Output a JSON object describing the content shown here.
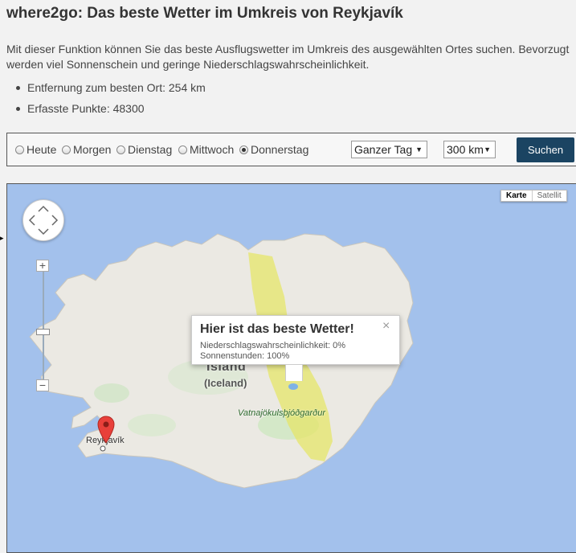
{
  "page": {
    "title": "where2go: Das beste Wetter im Umkreis von Reykjavík",
    "intro": "Mit dieser Funktion können Sie das beste Ausflugswetter im Umkreis des ausgewählten Ortes suchen. Bevorzugt werden viel Sonnenschein und geringe Niederschlagswahrscheinlichkeit.",
    "facts": [
      "Entfernung zum besten Ort: 254 km",
      "Erfasste Punkte: 48300"
    ]
  },
  "search": {
    "days": [
      {
        "label": "Heute",
        "checked": false
      },
      {
        "label": "Morgen",
        "checked": false
      },
      {
        "label": "Dienstag",
        "checked": false
      },
      {
        "label": "Mittwoch",
        "checked": false
      },
      {
        "label": "Donnerstag",
        "checked": true
      }
    ],
    "time_select": "Ganzer Tag",
    "radius_select": "300 km",
    "submit_label": "Suchen",
    "accent_color": "#1b4462"
  },
  "map": {
    "maptype_active": "Karte",
    "maptype_inactive": "Satellit",
    "zoom_in": "+",
    "zoom_out": "−",
    "country_label": "Ísland",
    "country_label_en": "(Iceland)",
    "park_label": "Vatnajökulsþjóðgarður",
    "city_label": "Reykjavík",
    "water_color": "#a3c1ec",
    "highlight_color": "#e5e66a"
  },
  "infowindow": {
    "title": "Hier ist das beste Wetter!",
    "precip_line": "Niederschlagswahrscheinlichkeit: 0%",
    "sun_line": "Sonnenstunden: 100%",
    "close": "×"
  }
}
